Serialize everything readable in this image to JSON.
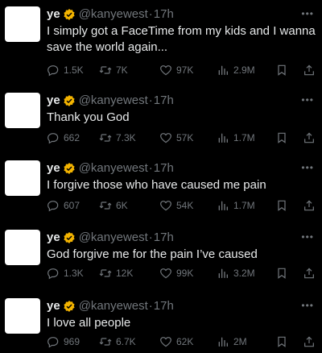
{
  "colors": {
    "background": "#000000",
    "text": "#e7e9ea",
    "muted": "#71767b",
    "verified": "#f4b400"
  },
  "tweets": [
    {
      "name": "ye",
      "handle": "@kanyewest",
      "dot": "·",
      "time": "17h",
      "more": "•••",
      "text": "I simply got a FaceTime from my kids and I wanna save the world again...",
      "replies": "1.5K",
      "retweets": "7K",
      "likes": "97K",
      "views": "2.9M"
    },
    {
      "name": "ye",
      "handle": "@kanyewest",
      "dot": "·",
      "time": "17h",
      "more": "•••",
      "text": "Thank you God",
      "replies": "662",
      "retweets": "7.3K",
      "likes": "57K",
      "views": "1.7M"
    },
    {
      "name": "ye",
      "handle": "@kanyewest",
      "dot": "·",
      "time": "17h",
      "more": "•••",
      "text": "I forgive those who have caused me pain",
      "replies": "607",
      "retweets": "6K",
      "likes": "54K",
      "views": "1.7M"
    },
    {
      "name": "ye",
      "handle": "@kanyewest",
      "dot": "·",
      "time": "17h",
      "more": "•••",
      "text": "God forgive me for the pain I’ve caused",
      "replies": "1.3K",
      "retweets": "12K",
      "likes": "99K",
      "views": "3.2M"
    },
    {
      "name": "ye",
      "handle": "@kanyewest",
      "dot": "·",
      "time": "17h",
      "more": "•••",
      "text": "I love all people",
      "replies": "969",
      "retweets": "6.7K",
      "likes": "62K",
      "views": "2M"
    }
  ]
}
